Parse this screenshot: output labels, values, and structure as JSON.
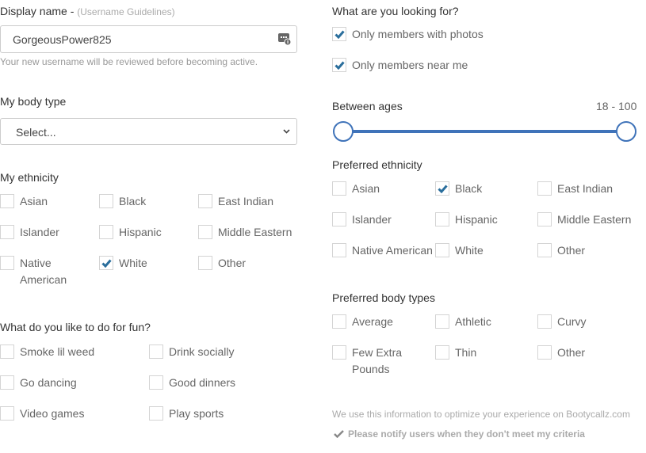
{
  "display_name": {
    "label": "Display name -",
    "guidelines_link": "(Username Guidelines)",
    "value": "GorgeousPower825",
    "icon": "keyboard-badge-icon",
    "note": "Your new username will be reviewed before becoming active."
  },
  "body_type": {
    "label": "My body type",
    "selected": "Select..."
  },
  "my_ethnicity": {
    "label": "My ethnicity",
    "options": [
      {
        "label": "Asian",
        "checked": false
      },
      {
        "label": "Black",
        "checked": false
      },
      {
        "label": "East Indian",
        "checked": false
      },
      {
        "label": "Islander",
        "checked": false
      },
      {
        "label": "Hispanic",
        "checked": false
      },
      {
        "label": "Middle Eastern",
        "checked": false
      },
      {
        "label": "Native American",
        "checked": false
      },
      {
        "label": "White",
        "checked": true
      },
      {
        "label": "Other",
        "checked": false
      }
    ]
  },
  "fun": {
    "label": "What do you like to do for fun?",
    "options": [
      {
        "label": "Smoke lil weed",
        "checked": false
      },
      {
        "label": "Drink socially",
        "checked": false
      },
      {
        "label": "Go dancing",
        "checked": false
      },
      {
        "label": "Good dinners",
        "checked": false
      },
      {
        "label": "Video games",
        "checked": false
      },
      {
        "label": "Play sports",
        "checked": false
      }
    ]
  },
  "looking_for": {
    "label": "What are you looking for?",
    "options": [
      {
        "label": "Only members with photos",
        "checked": true
      },
      {
        "label": "Only members near me",
        "checked": true
      }
    ]
  },
  "ages": {
    "label": "Between ages",
    "range_text": "18 - 100",
    "min": 18,
    "max": 100
  },
  "preferred_ethnicity": {
    "label": "Preferred ethnicity",
    "options": [
      {
        "label": "Asian",
        "checked": false
      },
      {
        "label": "Black",
        "checked": true
      },
      {
        "label": "East Indian",
        "checked": false
      },
      {
        "label": "Islander",
        "checked": false
      },
      {
        "label": "Hispanic",
        "checked": false
      },
      {
        "label": "Middle Eastern",
        "checked": false
      },
      {
        "label": "Native American",
        "checked": false
      },
      {
        "label": "White",
        "checked": false
      },
      {
        "label": "Other",
        "checked": false
      }
    ]
  },
  "preferred_body_types": {
    "label": "Preferred body types",
    "options": [
      {
        "label": "Average",
        "checked": false
      },
      {
        "label": "Athletic",
        "checked": false
      },
      {
        "label": "Curvy",
        "checked": false
      },
      {
        "label": "Few Extra Pounds",
        "checked": false
      },
      {
        "label": "Thin",
        "checked": false
      },
      {
        "label": "Other",
        "checked": false
      }
    ]
  },
  "footer": {
    "info_text": "We use this information to optimize your experience on Bootycallz.com",
    "notify_text": "Please notify users when they don't meet my criteria",
    "notify_checked": true
  },
  "colors": {
    "check": "#2a6e9c",
    "slider": "#3f73b9"
  }
}
